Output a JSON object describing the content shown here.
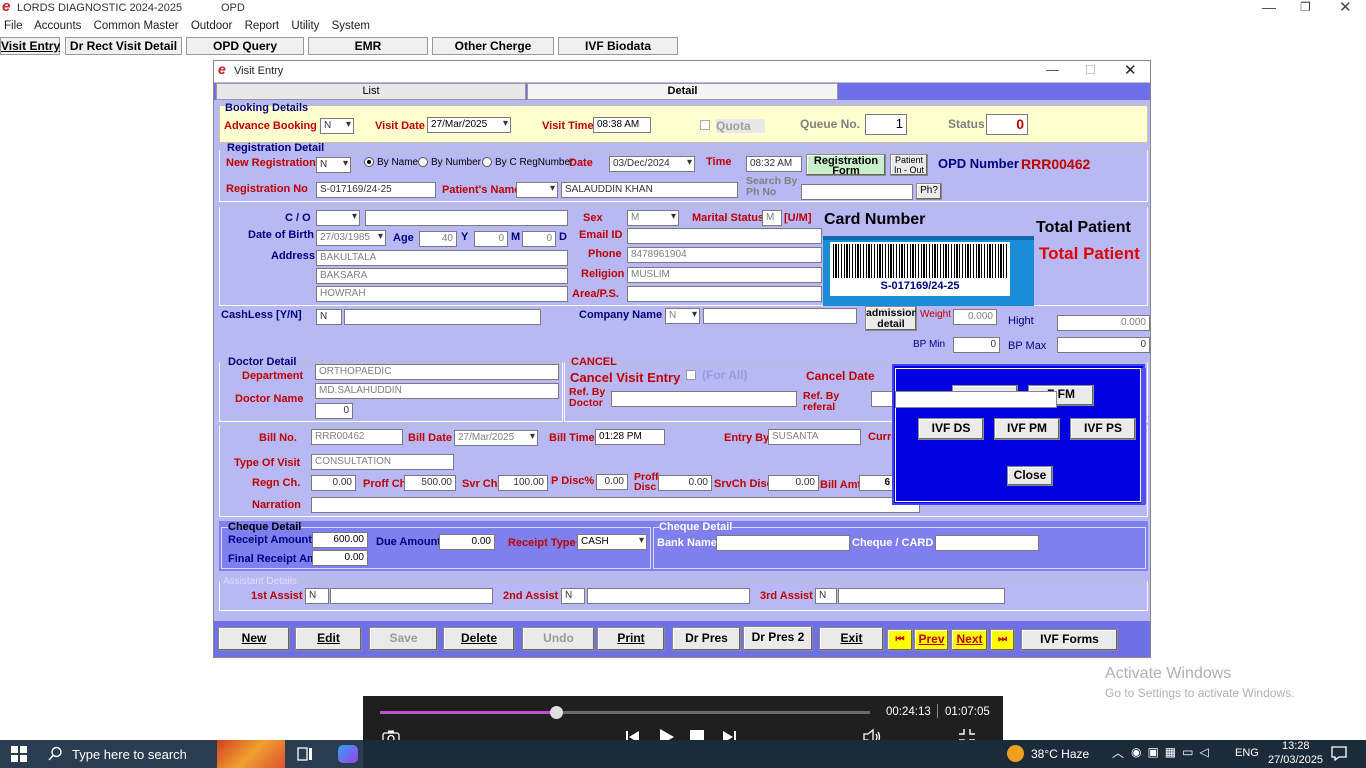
{
  "app": {
    "title": "LORDS DIAGNOSTIC 2024-2025",
    "module": "OPD",
    "logo_glyph": "e"
  },
  "menu": [
    "File",
    "Accounts",
    "Common Master",
    "Outdoor",
    "Report",
    "Utility",
    "System"
  ],
  "toolbar": [
    "Visit Entry",
    "Dr Rect Visit Detail",
    "OPD Query",
    "EMR",
    "Other Cherge",
    "IVF Biodata"
  ],
  "window": {
    "title": "Visit Entry",
    "tabs": [
      "List",
      "Detail"
    ],
    "active_tab": "Detail"
  },
  "booking": {
    "title": "Booking Details",
    "advance_label": "Advance Booking",
    "advance_value": "N",
    "visit_date_label": "Visit Date",
    "visit_date": "27/Mar/2025",
    "visit_time_label": "Visit Time",
    "visit_time": "08:38 AM",
    "quota_label": "Quota",
    "queue_label": "Queue No.",
    "queue_value": "1",
    "status_label": "Status",
    "status_value": "0"
  },
  "registration": {
    "title": "Registration Detail",
    "new_reg_label": "New Registration",
    "new_reg_value": "N",
    "radio": [
      "By Name",
      "By Number",
      "By C RegNumber"
    ],
    "date_label": "Date",
    "date_value": "03/Dec/2024",
    "time_label": "Time",
    "time_value": "08:32 AM",
    "reg_form_button": "Registration Form",
    "patient_inout_button": "Patient In - Out",
    "opd_label": "OPD Number",
    "opd_value": "RRR00462",
    "reg_no_label": "Registration No",
    "reg_no_value": "S-017169/24-25",
    "patient_name_label": "Patient's Name",
    "patient_name_value": "SALAUDDIN KHAN",
    "search_by_label": "Search By Ph No",
    "ph_button": "Ph?"
  },
  "patient": {
    "co_label": "C / O",
    "dob_label": "Date of Birth",
    "dob_value": "27/03/1985",
    "age_label": "Age",
    "age_y": "40",
    "y_label": "Y",
    "age_m": "0",
    "m_label": "M",
    "age_d": "0",
    "d_label": "D",
    "address_label": "Address",
    "address": [
      "BAKULTALA",
      "BAKSARA",
      "HOWRAH"
    ],
    "sex_label": "Sex",
    "sex_value": "M",
    "marital_label": "Marital Status",
    "marital_value": "M",
    "marital_hint": "[U/M]",
    "email_label": "Email ID",
    "phone_label": "Phone",
    "phone_value": "8478961904",
    "religion_label": "Religion",
    "religion_value": "MUSLIM",
    "area_label": "Area/P.S.",
    "card_number_label": "Card Number",
    "card_number_value": "S-017169/24-25",
    "total_patient_label": "Total Patient",
    "total_patient_value": "Total Patient"
  },
  "cashless": {
    "label": "CashLess [Y/N]",
    "value": "N",
    "company_label": "Company Name",
    "company_value": "N",
    "admission_button": "admission detail",
    "weight_label": "Weight",
    "weight_value": "0.000",
    "hight_label": "Hight",
    "hight_value": "0.000",
    "bpmin_label": "BP Min",
    "bpmin_value": "0",
    "bpmax_label": "BP Max",
    "bpmax_value": "0"
  },
  "doctor": {
    "title": "Doctor Detail",
    "dept_label": "Department",
    "dept_value": "ORTHOPAEDIC",
    "name_label": "Doctor Name",
    "name_value": "MD.SALAHUDDIN",
    "extra_value": "0"
  },
  "cancel": {
    "title": "CANCEL",
    "visit_label": "Cancel Visit Entry",
    "for_all": "(For All)",
    "date_label": "Cancel Date",
    "ref_doctor_label": "Ref. By Doctor",
    "ref_referal_label": "Ref. By referal"
  },
  "ivf_popup": {
    "partial": "F FM",
    "buttons": [
      "IVF DS",
      "IVF PM",
      "IVF PS"
    ],
    "close": "Close"
  },
  "bill": {
    "bill_no_label": "Bill No.",
    "bill_no_value": "RRR00462",
    "bill_date_label": "Bill Date",
    "bill_date_value": "27/Mar/2025",
    "bill_time_label": "Bill Time",
    "bill_time_value": "01:28 PM",
    "entry_by_label": "Entry By",
    "entry_by_value": "SUSANTA",
    "curr_label": "Curre",
    "type_label": "Type Of Visit",
    "type_value": "CONSULTATION",
    "regn_label": "Regn Ch.",
    "regn_value": "0.00",
    "proff_label": "Proff Ch",
    "proff_value": "500.00",
    "svr_label": "Svr Ch.",
    "svr_value": "100.00",
    "pdisc_label": "P Disc%",
    "pdisc_value": "0.00",
    "proff_disc_label": "Proff Disc",
    "proff_disc_value": "0.00",
    "srvch_label": "SrvCh Disc",
    "srvch_value": "0.00",
    "bill_amt_label": "Bill Amt",
    "bill_amt_value": "6",
    "narration_label": "Narration"
  },
  "cheque": {
    "title": "Cheque Detail",
    "receipt_label": "Receipt Amount",
    "receipt_value": "600.00",
    "due_label": "Due Amount",
    "due_value": "0.00",
    "receipt_type_label": "Receipt Type",
    "receipt_type_value": "CASH",
    "final_label": "Final Receipt Amt",
    "final_value": "0.00",
    "title2": "Cheque Detail",
    "bank_label": "Bank Name",
    "card_label": "Cheque / CARD"
  },
  "assistant": {
    "title": "Assistant Details",
    "a1_label": "1st Assist",
    "a1_value": "N",
    "a2_label": "2nd Assist",
    "a2_value": "N",
    "a3_label": "3rd Assist",
    "a3_value": "N"
  },
  "actions": [
    "New",
    "Edit",
    "Save",
    "Delete",
    "Undo",
    "Print",
    "Dr Pres",
    "Dr Pres 2",
    "Exit"
  ],
  "nav": {
    "first": "⏮",
    "prev": "Prev",
    "next": "Next",
    "last": "⏭",
    "ivf_forms": "IVF Forms"
  },
  "watermark": {
    "line1": "Activate Windows",
    "line2": "Go to Settings to activate Windows."
  },
  "player": {
    "current": "00:24:13",
    "total": "01:07:05",
    "progress": 0.36
  },
  "taskbar": {
    "search_placeholder": "Type here to search",
    "weather": "38°C Haze",
    "lang": "ENG",
    "time": "13:28",
    "date": "27/03/2025"
  },
  "colors": {
    "form_bg": "#b8b8f4",
    "yellow_bg": "#ffffd0",
    "popup_bg": "#0000e0",
    "tab_bar": "#6f6fe8",
    "nav_yellow": "#ffff00"
  }
}
